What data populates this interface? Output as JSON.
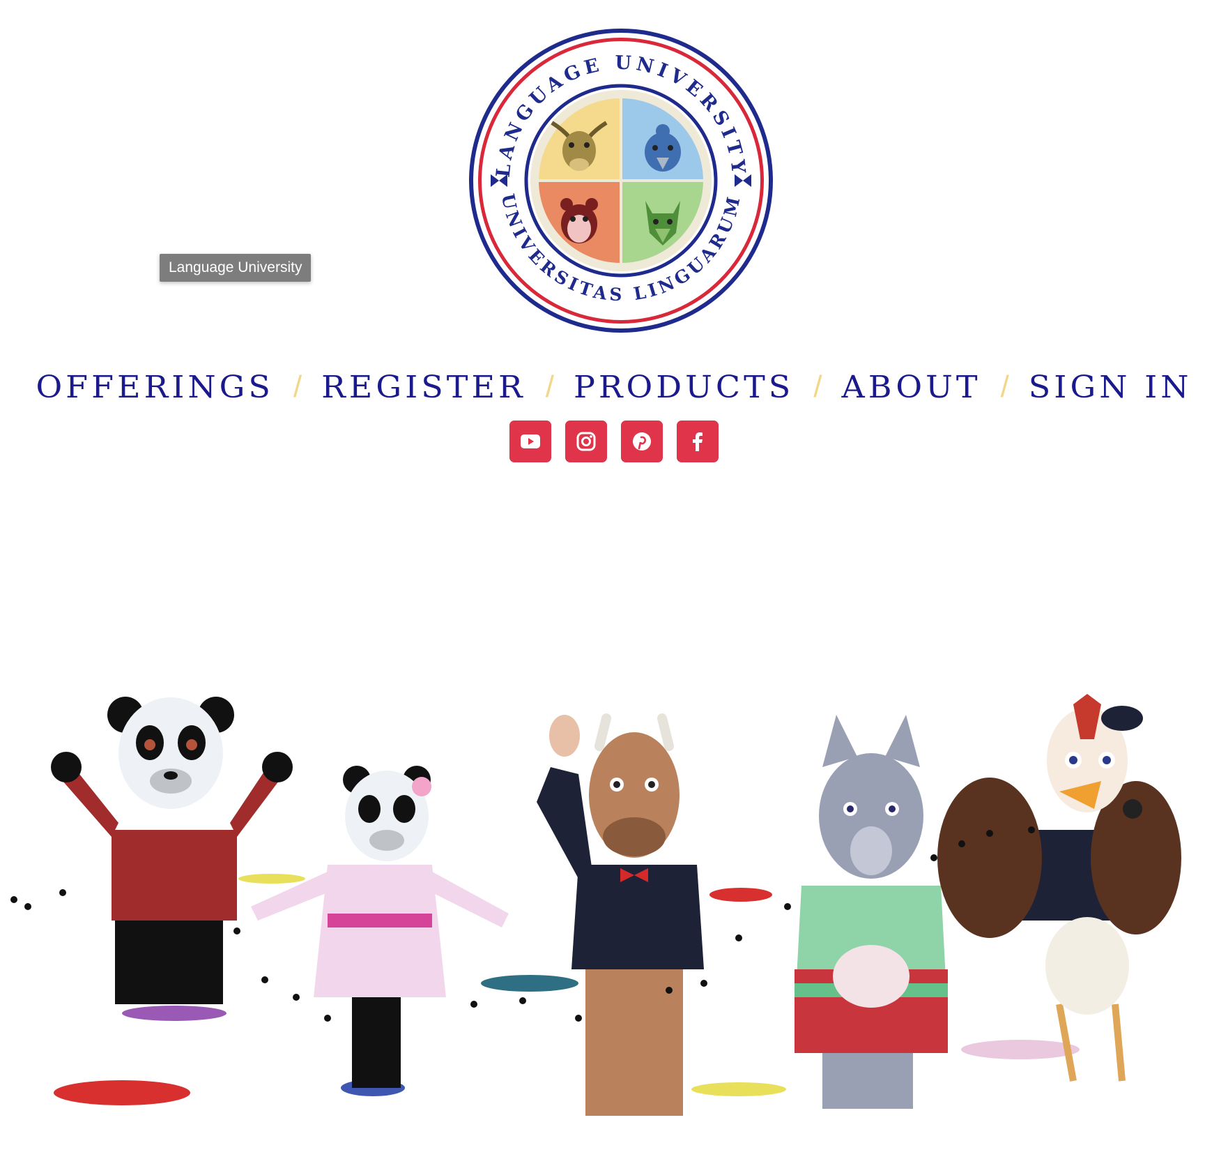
{
  "logo": {
    "top_text": "LANGUAGE UNIVERSITY",
    "bottom_text": "UNIVERSITAS LINGUARUM",
    "colors": {
      "ring_outer": "#1f2b8c",
      "ring_red": "#d8283a",
      "ring_bg": "#ffffff",
      "quad_yellow": "#f5d98c",
      "quad_blue": "#9cc8ea",
      "quad_orange": "#ea8a62",
      "quad_green": "#a8d68f",
      "inner_bg": "#efe9d8"
    }
  },
  "tooltip": {
    "text": "Language University"
  },
  "nav": {
    "items": [
      {
        "label": "OFFERINGS"
      },
      {
        "label": "REGISTER"
      },
      {
        "label": "PRODUCTS"
      },
      {
        "label": "ABOUT"
      },
      {
        "label": "SIGN IN"
      }
    ],
    "separator": "/",
    "colors": {
      "link": "#1a1a8c",
      "separator": "#f0d78a"
    }
  },
  "social": {
    "items": [
      {
        "icon": "youtube-icon"
      },
      {
        "icon": "instagram-icon"
      },
      {
        "icon": "pinterest-icon"
      },
      {
        "icon": "facebook-icon"
      }
    ],
    "color": "#e0344a"
  },
  "hero": {
    "characters": [
      "panda",
      "panda-girl",
      "bull",
      "wolf",
      "rooster"
    ]
  }
}
